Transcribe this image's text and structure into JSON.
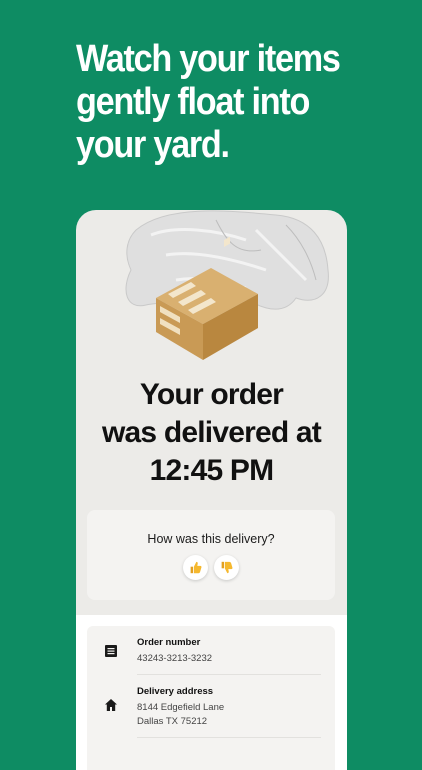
{
  "headline": {
    "line1": "Watch your items",
    "line2": "gently float into",
    "line3": "your yard."
  },
  "status": {
    "line1": "Your order",
    "line2": "was delivered at",
    "time": "12:45 PM"
  },
  "rating": {
    "question": "How was this delivery?",
    "up_icon": "thumbs-up-icon",
    "down_icon": "thumbs-down-icon"
  },
  "details": {
    "order_label": "Order number",
    "order_value": "43243-3213-3232",
    "address_label": "Delivery address",
    "address_line1": "8144 Edgefield Lane",
    "address_line2": "Dallas TX 75212"
  },
  "colors": {
    "background": "#0e8c63",
    "card": "#ecebe8",
    "box": "#c99a55"
  }
}
